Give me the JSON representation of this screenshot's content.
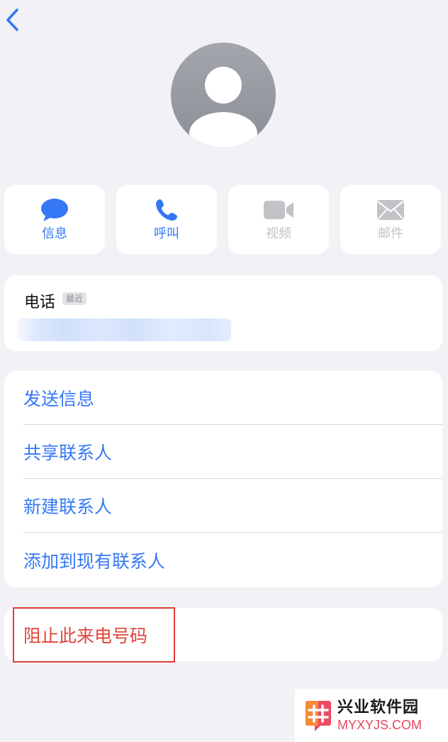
{
  "navigation": {
    "back_icon": "chevron-left-icon",
    "accent_color": "#3478f6"
  },
  "avatar": {
    "icon": "person-silhouette-icon"
  },
  "actions": [
    {
      "label": "信息",
      "icon": "message-bubble-icon",
      "enabled": true
    },
    {
      "label": "呼叫",
      "icon": "phone-icon",
      "enabled": true
    },
    {
      "label": "视频",
      "icon": "video-camera-icon",
      "enabled": false
    },
    {
      "label": "邮件",
      "icon": "envelope-icon",
      "enabled": false
    }
  ],
  "phone": {
    "label": "电话",
    "badge": "最近"
  },
  "menu": {
    "items": [
      "发送信息",
      "共享联系人",
      "新建联系人",
      "添加到现有联系人"
    ]
  },
  "block": {
    "label": "阻止此来电号码",
    "color": "#e0443a",
    "highlight_color": "#e53b35"
  },
  "watermark": {
    "title": "兴业软件园",
    "url": "MYXYJS.COM"
  }
}
